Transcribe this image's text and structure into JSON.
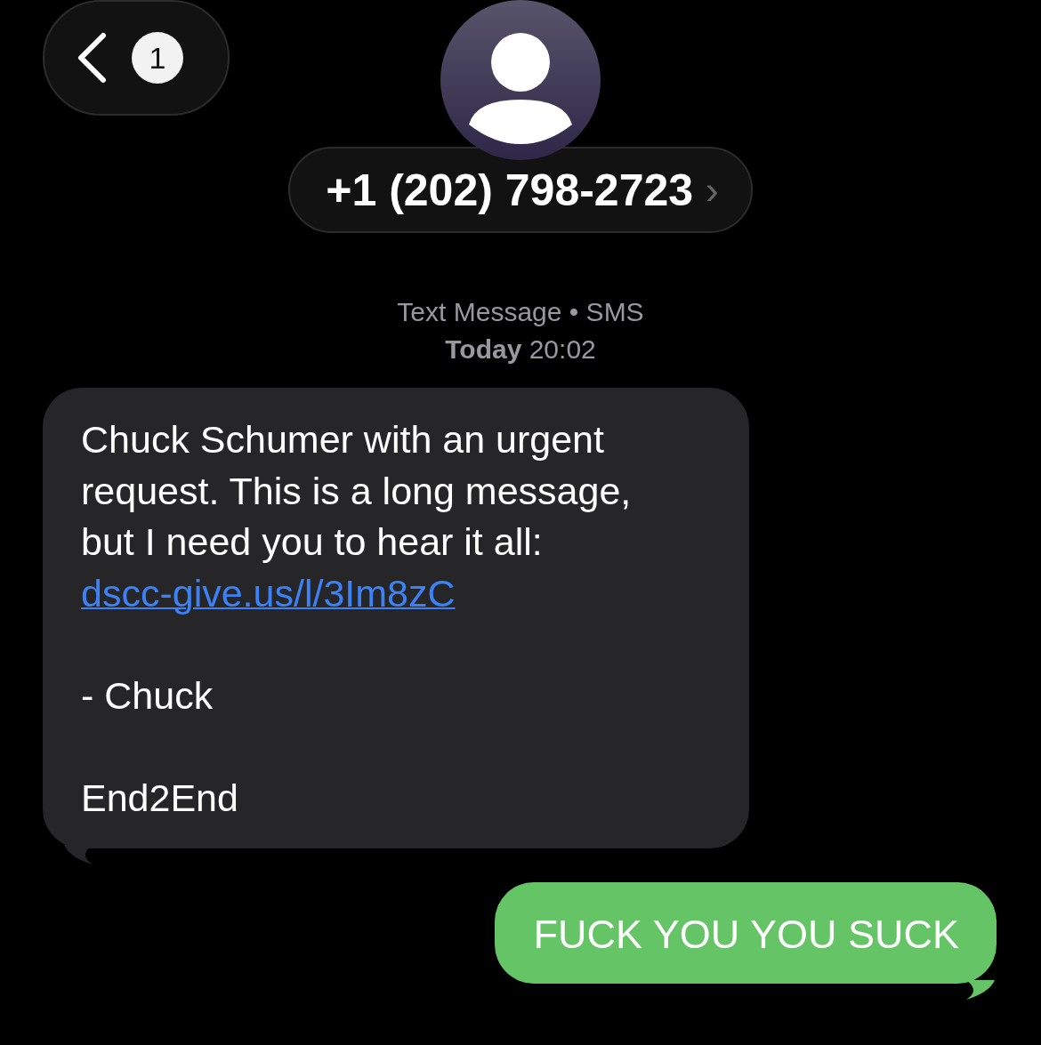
{
  "header": {
    "back_badge": "1",
    "contact": "+1 (202) 798-2723",
    "chevron": "›"
  },
  "service": "Text Message • SMS",
  "timestamp": {
    "day": "Today",
    "time": "20:02"
  },
  "messages": [
    {
      "kind": "incoming",
      "parts": [
        {
          "kind": "text",
          "text": "Chuck Schumer with an urgent request. This is a long message, but I need you to hear it all:"
        },
        {
          "kind": "link",
          "text": "dscc-give.us/l/3Im8zC"
        },
        {
          "kind": "gap"
        },
        {
          "kind": "text",
          "text": "- Chuck"
        },
        {
          "kind": "gap"
        },
        {
          "kind": "text",
          "text": "End2End"
        }
      ]
    },
    {
      "kind": "outgoing",
      "parts": [
        {
          "kind": "text",
          "text": "FUCK YOU YOU SUCK"
        }
      ]
    }
  ]
}
